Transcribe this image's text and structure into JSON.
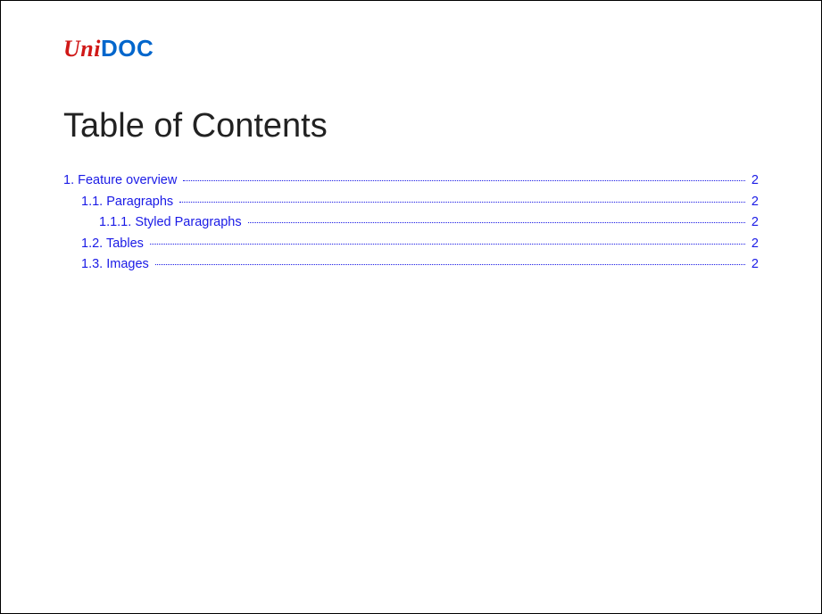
{
  "logo": {
    "part1": "Uni",
    "part2": "DOC"
  },
  "title": "Table of Contents",
  "toc": {
    "entries": [
      {
        "number": "1.",
        "label": "Feature overview",
        "page": "2",
        "indent": 0
      },
      {
        "number": "1.1.",
        "label": "Paragraphs",
        "page": "2",
        "indent": 1
      },
      {
        "number": "1.1.1.",
        "label": "Styled Paragraphs",
        "page": "2",
        "indent": 2
      },
      {
        "number": "1.2.",
        "label": "Tables",
        "page": "2",
        "indent": 1
      },
      {
        "number": "1.3.",
        "label": "Images",
        "page": "2",
        "indent": 1
      }
    ]
  }
}
